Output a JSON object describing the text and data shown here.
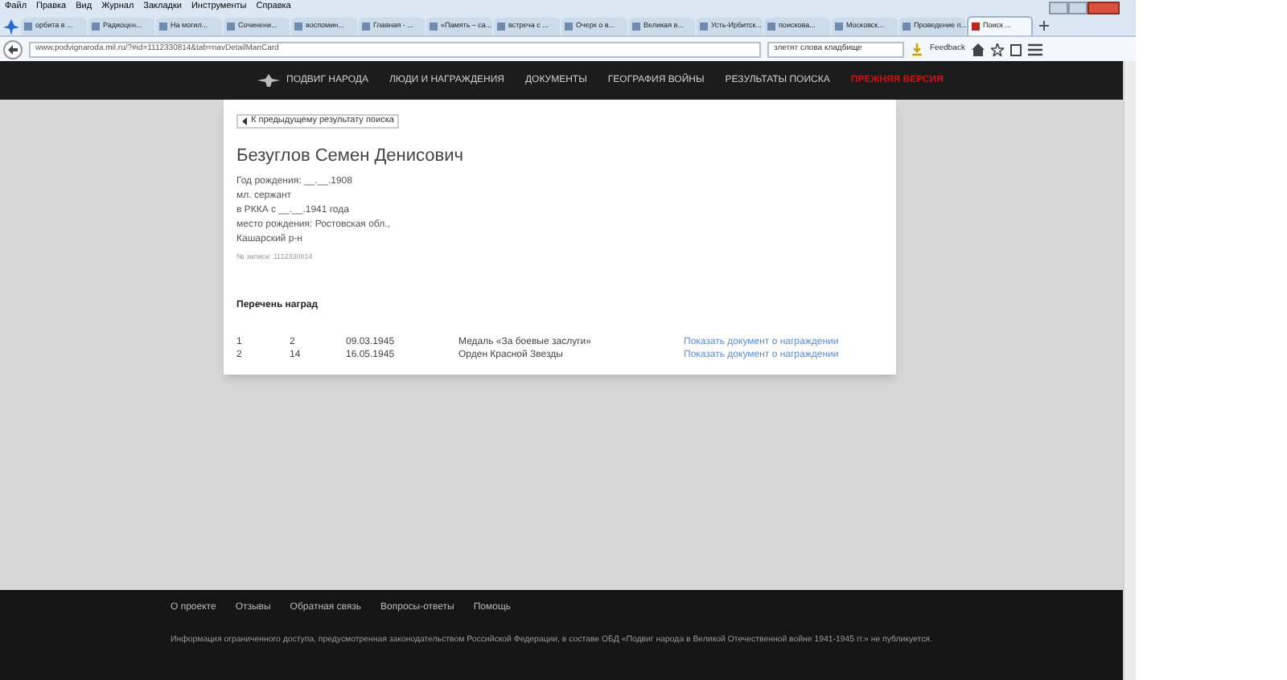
{
  "menu_bar": [
    "Файл",
    "Правка",
    "Вид",
    "Журнал",
    "Закладки",
    "Инструменты",
    "Справка"
  ],
  "tabs": [
    {
      "label": "орбита в ...",
      "selected": false
    },
    {
      "label": "Радиоцен...",
      "selected": false
    },
    {
      "label": "На могил...",
      "selected": false
    },
    {
      "label": "Сочинени...",
      "selected": false
    },
    {
      "label": "воспомин...",
      "selected": false
    },
    {
      "label": "Главная - ...",
      "selected": false
    },
    {
      "label": "«Память – са...",
      "selected": false
    },
    {
      "label": "встреча с ...",
      "selected": false
    },
    {
      "label": "Очерк о в...",
      "selected": false
    },
    {
      "label": "Великая в...",
      "selected": false
    },
    {
      "label": "Усть-Ирбитск...",
      "selected": false
    },
    {
      "label": "поисковa...",
      "selected": false
    },
    {
      "label": "Московск...",
      "selected": false
    },
    {
      "label": "Проведение п...",
      "selected": false
    },
    {
      "label": "Поиск ...",
      "selected": true
    }
  ],
  "toolbar": {
    "url": "www.podvignaroda.mil.ru/?#id=1112330814&tab=navDetailManCard",
    "search": "злетят слова кладбище",
    "feedback": "Feedback"
  },
  "site_nav": [
    {
      "label": "ПОДВИГ НАРОДА",
      "kind": "logo"
    },
    {
      "label": "ЛЮДИ И НАГРАЖДЕНИЯ",
      "kind": "link"
    },
    {
      "label": "ДОКУМЕНТЫ",
      "kind": "link"
    },
    {
      "label": "ГЕОГРАФИЯ ВОЙНЫ",
      "kind": "link"
    },
    {
      "label": "РЕЗУЛЬТАТЫ ПОИСКА",
      "kind": "link"
    },
    {
      "label": "ПРЕЖНЯЯ ВЕРСИЯ",
      "kind": "highlight"
    }
  ],
  "card": {
    "back_button": "К предыдущему результату поиска",
    "name": "Безуглов Семен Денисович",
    "details": [
      "Год рождения: __.__.1908",
      "мл. сержант",
      "в РККА с __.__.1941 года",
      "место рождения: Ростовская обл.,",
      "Кашарский р-н"
    ],
    "record_number": "№ записи: 1112330814",
    "awards_title": "Перечень наград",
    "awards": [
      {
        "num": "1",
        "column_2": "2",
        "date": "09.03.1945",
        "award": "Медаль «За боевые заслуги»",
        "link": "Показать документ о награждении"
      },
      {
        "num": "2",
        "column_2": "14",
        "date": "16.05.1945",
        "award": "Орден Красной Звезды",
        "link": "Показать документ о награждении"
      }
    ]
  },
  "footer": {
    "links": [
      "О проекте",
      "Отзывы",
      "Обратная связь",
      "Вопросы-ответы",
      "Помощь"
    ],
    "notice": "Информация ограниченного доступа, предусмотренная законодательством Российской Федерации, в составе ОБД «Подвиг народа в Великой Отечественной войне 1941-1945 гг.» не публикуется."
  }
}
